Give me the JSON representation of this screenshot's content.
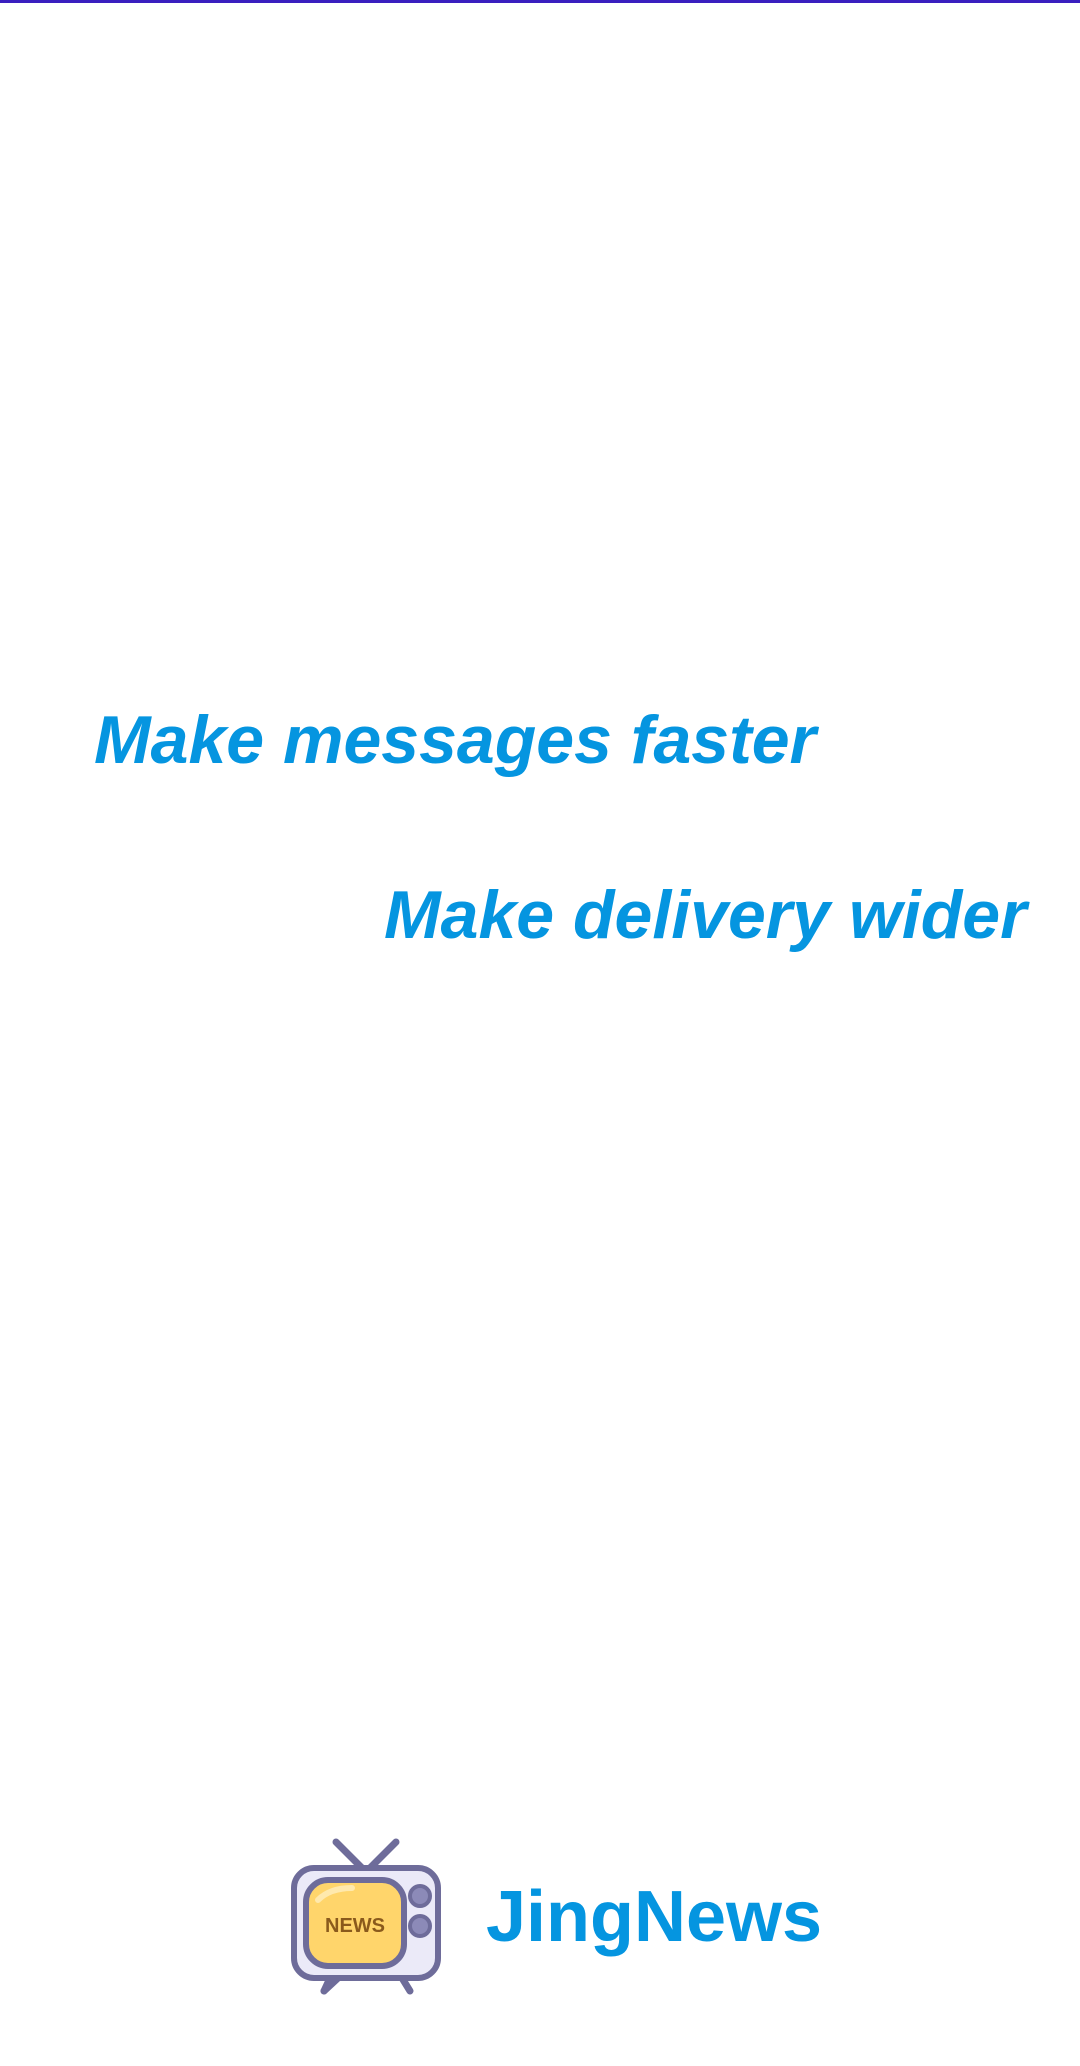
{
  "colors": {
    "accent": "#0595e0",
    "top_bar": "#3a1fbf",
    "background": "#ffffff"
  },
  "slogans": {
    "line1": "Make messages faster",
    "line2": "Make delivery wider"
  },
  "brand": {
    "logo_icon": "retro-tv-news-icon",
    "logo_text": "NEWS",
    "app_name": "JingNews"
  }
}
